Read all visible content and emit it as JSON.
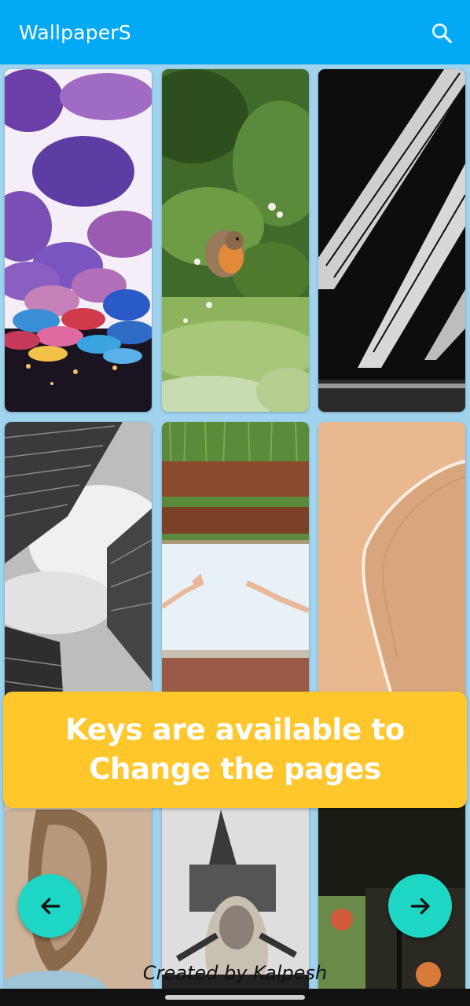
{
  "app": {
    "title": "WallpaperS"
  },
  "header": {
    "search_icon": "search-icon"
  },
  "banner": {
    "text": "Keys are available to\nChange the pages"
  },
  "nav": {
    "prev_icon": "arrow-left-icon",
    "next_icon": "arrow-right-icon"
  },
  "footer": {
    "credit": "Created by Kalpesh"
  },
  "colors": {
    "appbar": "#03a9f4",
    "background": "#9fd3ee",
    "banner": "#ffc72c",
    "fab": "#1dd6c4"
  },
  "wallpapers": [
    {
      "id": "umbrellas"
    },
    {
      "id": "robin-bird"
    },
    {
      "id": "black-white-building-stripes"
    },
    {
      "id": "skyscrapers-looking-up"
    },
    {
      "id": "hands-reaching-fence"
    },
    {
      "id": "beach-waves-sand"
    },
    {
      "id": "rock-crevice"
    },
    {
      "id": "woman-church-spire"
    },
    {
      "id": "dark-window"
    }
  ]
}
